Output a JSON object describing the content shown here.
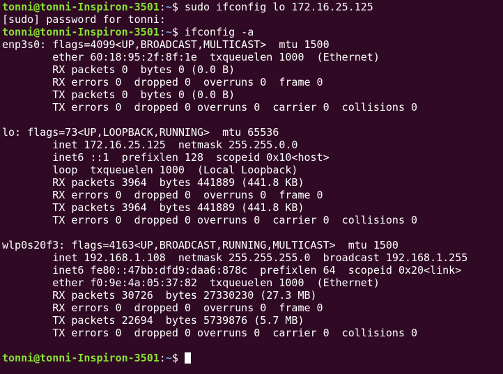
{
  "prompt": {
    "user_host": "tonni@tonni-Inspiron-3501",
    "path": "~",
    "symbol": "$"
  },
  "lines": [
    {
      "type": "prompt",
      "command": " sudo ifconfig lo 172.16.25.125"
    },
    {
      "type": "output",
      "text": "[sudo] password for tonni:"
    },
    {
      "type": "prompt",
      "command": " ifconfig -a"
    },
    {
      "type": "output",
      "text": "enp3s0: flags=4099<UP,BROADCAST,MULTICAST>  mtu 1500"
    },
    {
      "type": "output",
      "text": "        ether 60:18:95:2f:8f:1e  txqueuelen 1000  (Ethernet)"
    },
    {
      "type": "output",
      "text": "        RX packets 0  bytes 0 (0.0 B)"
    },
    {
      "type": "output",
      "text": "        RX errors 0  dropped 0  overruns 0  frame 0"
    },
    {
      "type": "output",
      "text": "        TX packets 0  bytes 0 (0.0 B)"
    },
    {
      "type": "output",
      "text": "        TX errors 0  dropped 0 overruns 0  carrier 0  collisions 0"
    },
    {
      "type": "output",
      "text": ""
    },
    {
      "type": "output",
      "text": "lo: flags=73<UP,LOOPBACK,RUNNING>  mtu 65536"
    },
    {
      "type": "output",
      "text": "        inet 172.16.25.125  netmask 255.255.0.0"
    },
    {
      "type": "output",
      "text": "        inet6 ::1  prefixlen 128  scopeid 0x10<host>"
    },
    {
      "type": "output",
      "text": "        loop  txqueuelen 1000  (Local Loopback)"
    },
    {
      "type": "output",
      "text": "        RX packets 3964  bytes 441889 (441.8 KB)"
    },
    {
      "type": "output",
      "text": "        RX errors 0  dropped 0  overruns 0  frame 0"
    },
    {
      "type": "output",
      "text": "        TX packets 3964  bytes 441889 (441.8 KB)"
    },
    {
      "type": "output",
      "text": "        TX errors 0  dropped 0 overruns 0  carrier 0  collisions 0"
    },
    {
      "type": "output",
      "text": ""
    },
    {
      "type": "output",
      "text": "wlp0s20f3: flags=4163<UP,BROADCAST,RUNNING,MULTICAST>  mtu 1500"
    },
    {
      "type": "output",
      "text": "        inet 192.168.1.108  netmask 255.255.255.0  broadcast 192.168.1.255"
    },
    {
      "type": "output",
      "text": "        inet6 fe80::47bb:dfd9:daa6:878c  prefixlen 64  scopeid 0x20<link>"
    },
    {
      "type": "output",
      "text": "        ether f0:9e:4a:05:37:82  txqueuelen 1000  (Ethernet)"
    },
    {
      "type": "output",
      "text": "        RX packets 30726  bytes 27330230 (27.3 MB)"
    },
    {
      "type": "output",
      "text": "        RX errors 0  dropped 0  overruns 0  frame 0"
    },
    {
      "type": "output",
      "text": "        TX packets 22694  bytes 5739876 (5.7 MB)"
    },
    {
      "type": "output",
      "text": "        TX errors 0  dropped 0 overruns 0  carrier 0  collisions 0"
    },
    {
      "type": "output",
      "text": ""
    },
    {
      "type": "prompt",
      "command": " ",
      "cursor": true
    }
  ],
  "colors": {
    "background": "#300a24",
    "text": "#ffffff",
    "prompt_user": "#8ae234",
    "prompt_path": "#729fcf"
  }
}
